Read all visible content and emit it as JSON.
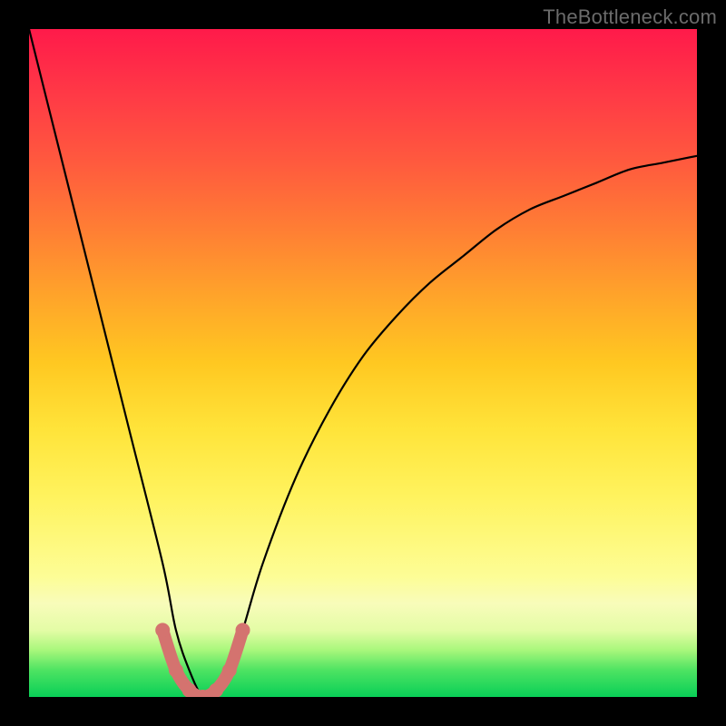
{
  "watermark": "TheBottleneck.com",
  "chart_data": {
    "type": "line",
    "title": "",
    "xlabel": "",
    "ylabel": "",
    "xlim": [
      0,
      100
    ],
    "ylim": [
      0,
      100
    ],
    "series": [
      {
        "name": "bottleneck-curve",
        "x": [
          0,
          5,
          10,
          15,
          20,
          22,
          24,
          26,
          28,
          30,
          32,
          35,
          40,
          45,
          50,
          55,
          60,
          65,
          70,
          75,
          80,
          85,
          90,
          95,
          100
        ],
        "values": [
          100,
          80,
          60,
          40,
          20,
          10,
          4,
          0,
          0,
          4,
          10,
          20,
          33,
          43,
          51,
          57,
          62,
          66,
          70,
          73,
          75,
          77,
          79,
          80,
          81
        ]
      },
      {
        "name": "highlight-segment",
        "x": [
          20,
          22,
          24,
          26,
          28,
          30,
          32
        ],
        "values": [
          10,
          4,
          1,
          0,
          1,
          4,
          10
        ]
      }
    ],
    "annotations": []
  },
  "colors": {
    "curve": "#000000",
    "highlight": "#d4736f",
    "watermark": "#6b6b6b"
  }
}
